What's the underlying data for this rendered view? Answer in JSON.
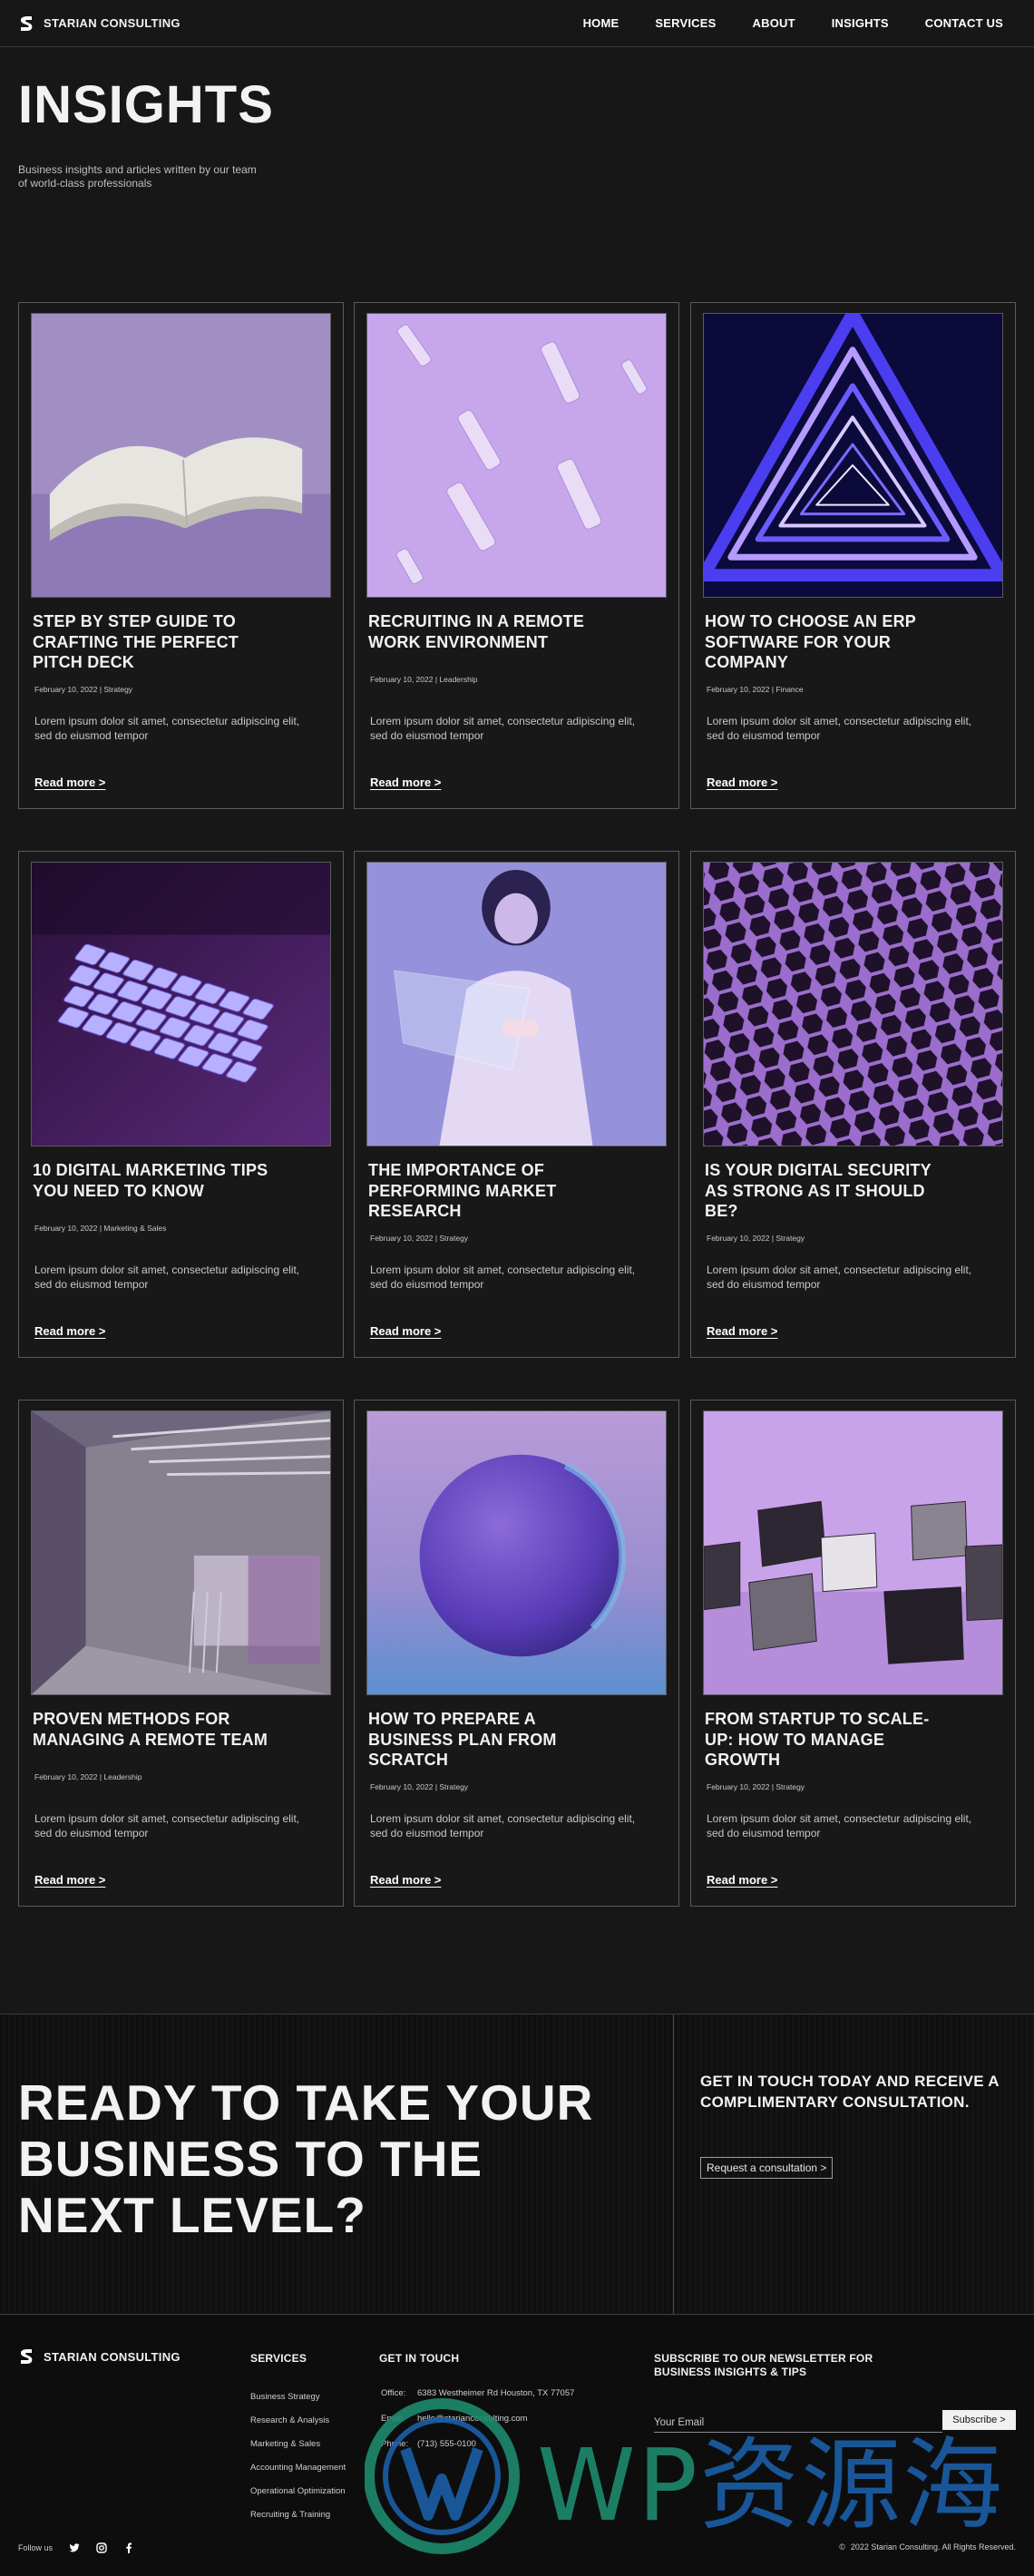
{
  "brand": {
    "name": "STARIAN CONSULTING"
  },
  "nav": [
    "HOME",
    "SERVICES",
    "ABOUT",
    "INSIGHTS",
    "CONTACT US"
  ],
  "hero": {
    "title": "INSIGHTS",
    "subtitle": "Business insights and articles written by our team of world-class professionals"
  },
  "cards": [
    {
      "title": "STEP BY STEP GUIDE TO CRAFTING THE PERFECT PITCH DECK",
      "meta": "February 10, 2022 | Strategy",
      "image": "open-book",
      "excerpt": "Lorem ipsum dolor sit amet, consectetur adipiscing elit, sed do eiusmod tempor",
      "more": "Read more >"
    },
    {
      "title": "RECRUITING IN A REMOTE WORK ENVIRONMENT",
      "meta": "February 10, 2022 | Leadership",
      "image": "vials",
      "excerpt": "Lorem ipsum dolor sit amet, consectetur adipiscing elit, sed do eiusmod tempor",
      "more": "Read more >"
    },
    {
      "title": "HOW TO CHOOSE AN ERP SOFTWARE FOR YOUR COMPANY",
      "meta": "February 10, 2022 | Finance",
      "image": "neon-triangle-tunnel",
      "excerpt": "Lorem ipsum dolor sit amet, consectetur adipiscing elit, sed do eiusmod tempor",
      "more": "Read more >"
    },
    {
      "title": "10 DIGITAL MARKETING TIPS YOU NEED TO KNOW",
      "meta": "February 10, 2022 | Marketing & Sales",
      "image": "keyboard",
      "excerpt": "Lorem ipsum dolor sit amet, consectetur adipiscing elit, sed do eiusmod tempor",
      "more": "Read more >"
    },
    {
      "title": "THE IMPORTANCE OF PERFORMING MARKET RESEARCH",
      "meta": "February 10, 2022 | Strategy",
      "image": "woman-glass-panel",
      "excerpt": "Lorem ipsum dolor sit amet, consectetur adipiscing elit, sed do eiusmod tempor",
      "more": "Read more >"
    },
    {
      "title": "IS YOUR DIGITAL SECURITY AS STRONG AS IT SHOULD BE?",
      "meta": "February 10, 2022 | Strategy",
      "image": "hex-mesh",
      "excerpt": "Lorem ipsum dolor sit amet, consectetur adipiscing elit, sed do eiusmod tempor",
      "more": "Read more >"
    },
    {
      "title": "PROVEN METHODS FOR MANAGING A REMOTE TEAM",
      "meta": "February 10, 2022 | Leadership",
      "image": "office-room",
      "excerpt": "Lorem ipsum dolor sit amet, consectetur adipiscing elit, sed do eiusmod tempor",
      "more": "Read more >"
    },
    {
      "title": "HOW TO PREPARE A BUSINESS PLAN FROM SCRATCH",
      "meta": "February 10, 2022 | Strategy",
      "image": "glass-sphere",
      "excerpt": "Lorem ipsum dolor sit amet, consectetur adipiscing elit, sed do eiusmod tempor",
      "more": "Read more >"
    },
    {
      "title": "FROM STARTUP TO SCALE-UP: HOW TO MANAGE GROWTH",
      "meta": "February 10, 2022 | Strategy",
      "image": "stone-cubes",
      "excerpt": "Lorem ipsum dolor sit amet, consectetur adipiscing elit, sed do eiusmod tempor",
      "more": "Read more >"
    }
  ],
  "cta": {
    "title": "READY TO TAKE YOUR BUSINESS TO THE NEXT LEVEL?",
    "side_text": "GET IN TOUCH TODAY AND RECEIVE A COMPLIMENTARY CONSULTATION.",
    "button": "Request a consultation >"
  },
  "footer": {
    "brand": "STARIAN CONSULTING",
    "services_title": "SERVICES",
    "services": [
      "Business Strategy",
      "Research & Analysis",
      "Marketing & Sales",
      "Accounting Management",
      "Operational Optimization",
      "Recruiting & Training"
    ],
    "contact_title": "GET IN TOUCH",
    "contact": [
      {
        "label": "Office:",
        "value": "6383 Westheimer Rd Houston, TX 77057"
      },
      {
        "label": "Email:",
        "value": "hello@starianconsulting.com"
      },
      {
        "label": "Phone:",
        "value": "(713) 555-0100"
      }
    ],
    "newsletter_title": "SUBSCRIBE TO OUR NEWSLETTER FOR BUSINESS INSIGHTS & TIPS",
    "email_placeholder": "Your Email",
    "subscribe": "Subscribe >",
    "follow": "Follow us",
    "social_icons": [
      "twitter-icon",
      "instagram-icon",
      "facebook-icon"
    ],
    "copyright_symbol": "©",
    "copyright": "2022 Starian Consulting. All Rights Reserved."
  },
  "watermark": {
    "text_latin": "WP",
    "text_cjk": "资源海"
  }
}
